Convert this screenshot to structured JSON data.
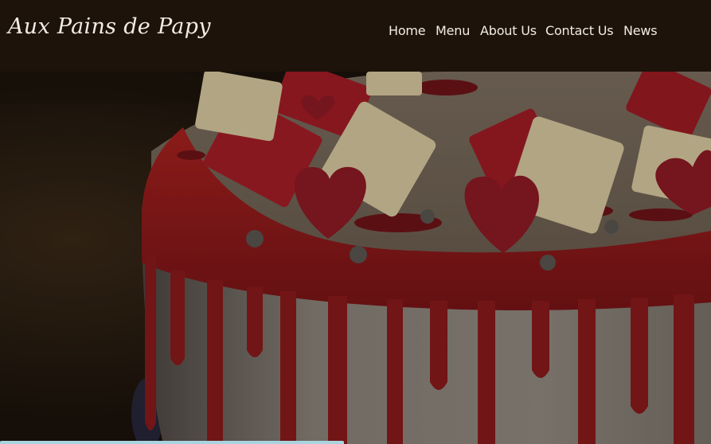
{
  "site": {
    "logo_text": "Aux Pains de Papy"
  },
  "nav": {
    "items": [
      {
        "label": "Home"
      },
      {
        "label": "Menu"
      },
      {
        "label": "About Us"
      },
      {
        "label": "Contact Us"
      },
      {
        "label": "News"
      }
    ]
  },
  "hero": {
    "image_subject": "cake-icon"
  },
  "colors": {
    "header_bg": "#1d130a",
    "nav_text": "#f2ece4",
    "glaze_red": "#8e1a1c",
    "frosting": "#8a8276"
  }
}
